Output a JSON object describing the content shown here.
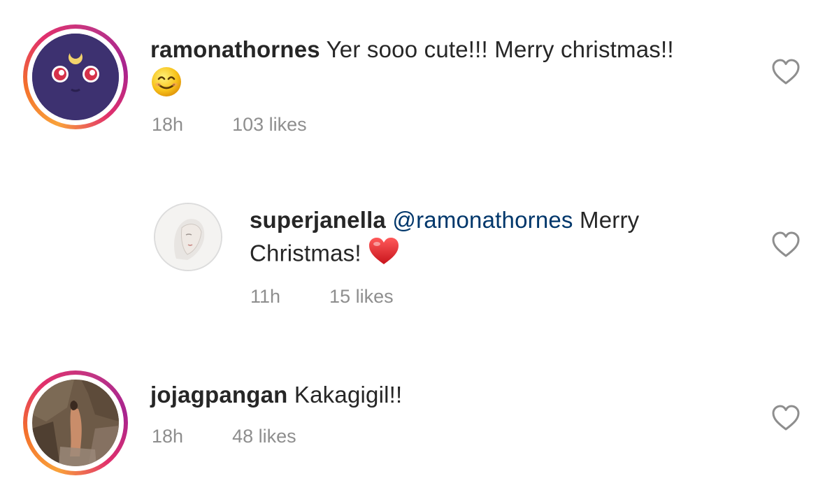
{
  "comments": [
    {
      "username": "ramonathornes",
      "text": "Yer sooo cute!!! Merry christmas!!",
      "emoji": "smiling-face",
      "time": "18h",
      "likes": "103 likes"
    },
    {
      "username": "superjanella",
      "mention": "@ramonathornes",
      "text_line1": "Merry",
      "text_line2": "Christmas!",
      "emoji": "red-heart",
      "time": "11h",
      "likes": "15 likes"
    },
    {
      "username": "jojagpangan",
      "text": "Kakagigil!!",
      "time": "18h",
      "likes": "48 likes"
    }
  ],
  "colors": {
    "text": "#262626",
    "meta": "#8e8e8e",
    "mention": "#00376b",
    "heart_outline": "#8e8e8e",
    "emoji_heart": "#e0262b"
  },
  "icons": {
    "like": "heart-outline-icon"
  }
}
